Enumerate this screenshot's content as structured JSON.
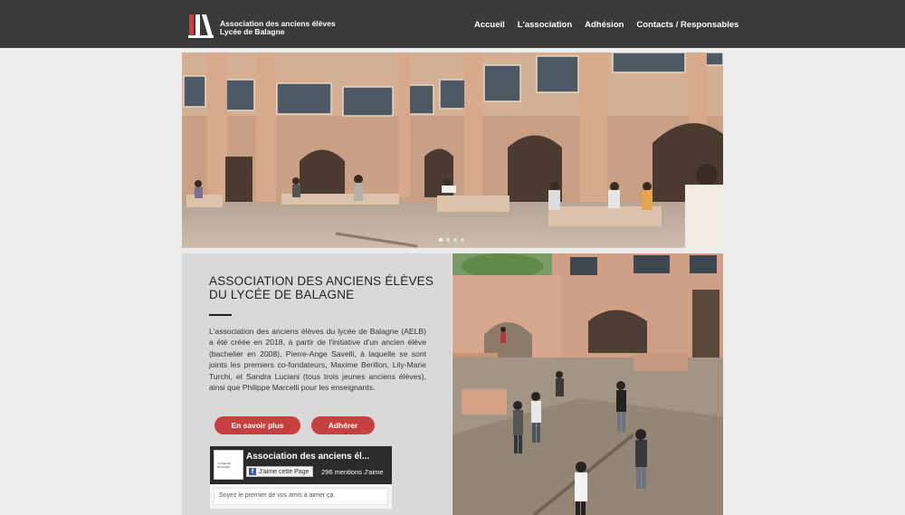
{
  "header": {
    "brand_line1": "Association des anciens élèves",
    "brand_line2": "Lycée de Balagne",
    "nav": [
      "Accueil",
      "L'association",
      "Adhésion",
      "Contacts / Responsables"
    ]
  },
  "hero": {
    "slides": 4,
    "active_slide": 1
  },
  "intro": {
    "title_line1": "ASSOCIATION DES ANCIENS ÉLÈVES",
    "title_line2": "DU LYCÉE DE BALAGNE",
    "text": "L'association des anciens élèves du lycée de Balagne (AELB) a été créée en 2018, à partir de l'initiative d'un ancien élève (bachelier en 2008), Pierre-Ange Savelli, à laquelle se sont joints les premiers co-fondateurs, Maxime Berillon, Lily-Marie Turchi, et Sandra Luciani (tous trois jeunes anciens élèves), ainsi que Philippe Marcelli pour les enseignants.",
    "btn_more": "En savoir plus",
    "btn_join": "Adhérer"
  },
  "facebook": {
    "page_name": "Association des anciens él...",
    "like_label": "J'aime cette Page",
    "likes_count": "296 mentions J'aime",
    "footer": "Soyez le premier de vos amis à aimer ça.",
    "thumb_text": "LYCÉE DE BALAGNE"
  },
  "colors": {
    "header_bg": "#3a3a3a",
    "accent": "#c64040",
    "panel_bg": "#d9d9d9"
  }
}
